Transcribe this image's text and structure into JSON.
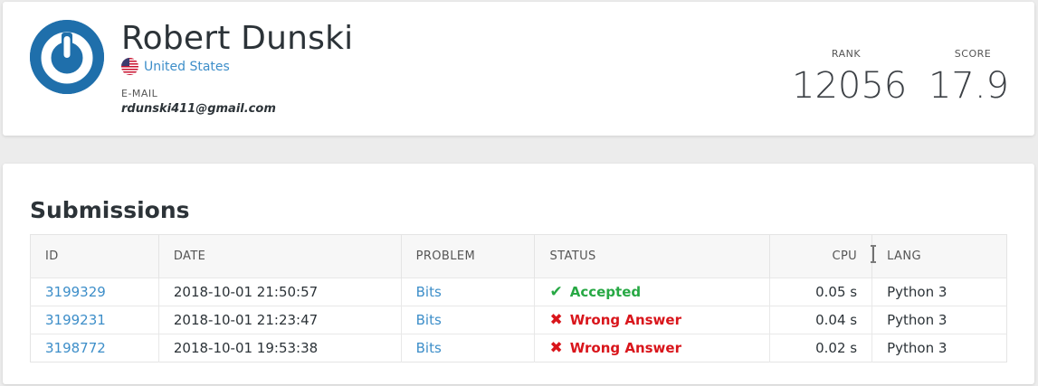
{
  "profile": {
    "name": "Robert Dunski",
    "country": "United States",
    "email_label": "E-MAIL",
    "email": "rdunski411@gmail.com",
    "rank_label": "RANK",
    "rank": "12056",
    "score_label": "SCORE",
    "score": "17.9"
  },
  "submissions": {
    "title": "Submissions",
    "columns": [
      "ID",
      "DATE",
      "PROBLEM",
      "STATUS",
      "CPU",
      "LANG"
    ],
    "rows": [
      {
        "id": "3199329",
        "date": "2018-10-01 21:50:57",
        "problem": "Bits",
        "status": "Accepted",
        "status_icon": "check-icon",
        "cpu": "0.05 s",
        "lang": "Python 3"
      },
      {
        "id": "3199231",
        "date": "2018-10-01 21:23:47",
        "problem": "Bits",
        "status": "Wrong Answer",
        "status_icon": "cross-icon",
        "cpu": "0.04 s",
        "lang": "Python 3"
      },
      {
        "id": "3198772",
        "date": "2018-10-01 19:53:38",
        "problem": "Bits",
        "status": "Wrong Answer",
        "status_icon": "cross-icon",
        "cpu": "0.02 s",
        "lang": "Python 3"
      }
    ]
  },
  "colors": {
    "accent_link": "#3d8ec9",
    "accepted": "#27a844",
    "wrong": "#d9151b",
    "avatar": "#1f6fab"
  }
}
